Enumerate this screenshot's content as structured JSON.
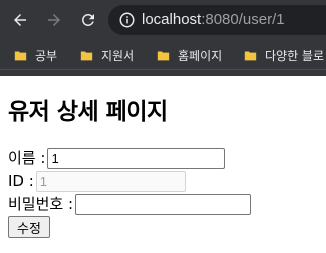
{
  "browser": {
    "url_host": "localhost",
    "url_rest": ":8080/user/1",
    "bookmarks": [
      {
        "label": "공부"
      },
      {
        "label": "지원서"
      },
      {
        "label": "홈페이지"
      },
      {
        "label": "다양한 블로"
      }
    ],
    "colors": {
      "chrome": "#35363a",
      "omnibox": "#202124",
      "folder": "#f3c440"
    }
  },
  "page": {
    "title": "유저 상세 페이지",
    "form": {
      "name_label": "이름 :",
      "name_value": "1",
      "id_label": "ID :",
      "id_value": "1",
      "password_label": "비밀번호 :",
      "password_value": "",
      "submit_label": "수정"
    }
  }
}
